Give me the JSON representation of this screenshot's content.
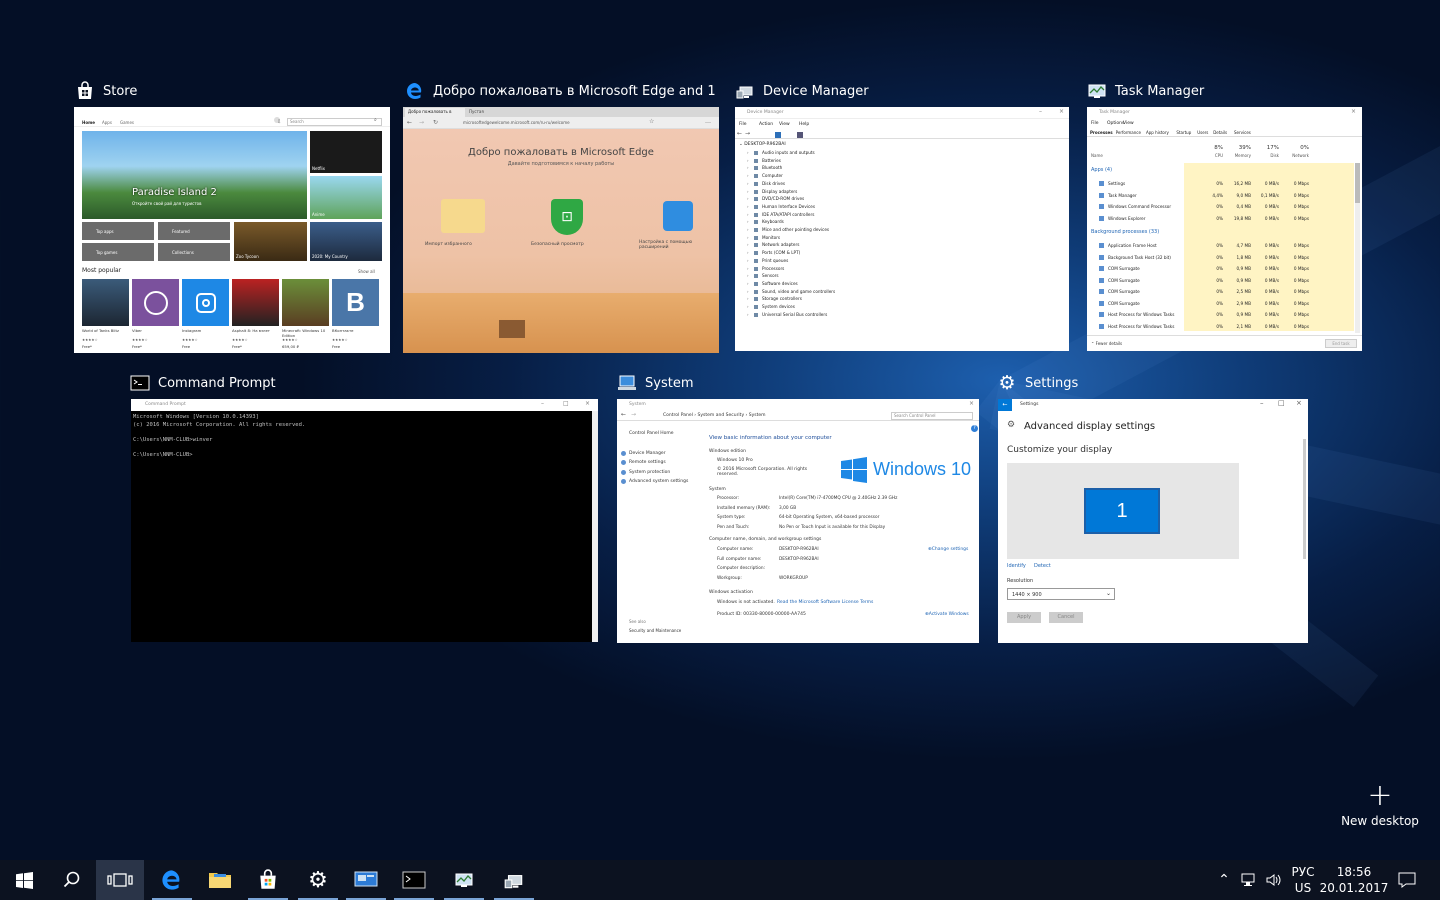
{
  "windows": {
    "store": {
      "title": "Store",
      "tabs": [
        "Home",
        "Apps",
        "Games"
      ],
      "search_placeholder": "Search",
      "hero_title": "Paradise Island 2",
      "hero_sub": "Откройте свой рай для туристов",
      "tiles": [
        "Top apps",
        "Featured",
        "Top games",
        "Collections"
      ],
      "side_tiles": [
        "Netflix",
        "Anime",
        "Zoo Tycoon",
        "2020: My Country"
      ],
      "section": "Most popular",
      "show_all": "Show all",
      "apps": [
        {
          "name": "World of Tanks Blitz",
          "price": "Free*"
        },
        {
          "name": "Viber",
          "price": "Free*"
        },
        {
          "name": "Instagram",
          "price": "Free"
        },
        {
          "name": "Asphalt 8: На взлет",
          "price": "Free*"
        },
        {
          "name": "Minecraft: Windows 10 Edition",
          "price": "659,00 ₽"
        },
        {
          "name": "ВКонтакте",
          "price": "Free"
        }
      ]
    },
    "edge": {
      "title": "Добро пожаловать в Microsoft Edge and 1 m...",
      "tab": "Добро пожаловать в",
      "tab2": "Пустая",
      "address": "microsoftedgewelcome.microsoft.com/ru-ru/welcome",
      "heading": "Добро пожаловать в Microsoft Edge",
      "subheading": "Давайте подготовимся к началу работы",
      "features": [
        "Импорт избранного",
        "Безопасный просмотр",
        "Настройка с помощью расширений"
      ]
    },
    "device_manager": {
      "title": "Device Manager",
      "menu": [
        "File",
        "Action",
        "View",
        "Help"
      ],
      "root": "DESKTOP-R962BAI",
      "items": [
        "Audio inputs and outputs",
        "Batteries",
        "Bluetooth",
        "Computer",
        "Disk drives",
        "Display adapters",
        "DVD/CD-ROM drives",
        "Human Interface Devices",
        "IDE ATA/ATAPI controllers",
        "Keyboards",
        "Mice and other pointing devices",
        "Monitors",
        "Network adapters",
        "Ports (COM & LPT)",
        "Print queues",
        "Processors",
        "Sensors",
        "Software devices",
        "Sound, video and game controllers",
        "Storage controllers",
        "System devices",
        "Universal Serial Bus controllers"
      ]
    },
    "task_manager": {
      "title": "Task Manager",
      "menu": [
        "File",
        "Options",
        "View"
      ],
      "tabs": [
        "Processes",
        "Performance",
        "App history",
        "Startup",
        "Users",
        "Details",
        "Services"
      ],
      "col_name": "Name",
      "cols": [
        {
          "pct": "8%",
          "label": "CPU"
        },
        {
          "pct": "39%",
          "label": "Memory"
        },
        {
          "pct": "17%",
          "label": "Disk"
        },
        {
          "pct": "0%",
          "label": "Network"
        }
      ],
      "apps_header": "Apps (4)",
      "apps": [
        {
          "name": "Settings",
          "cpu": "0%",
          "mem": "16,2 MB",
          "disk": "0 MB/s",
          "net": "0 Mbps"
        },
        {
          "name": "Task Manager",
          "cpu": "4,4%",
          "mem": "9,0 MB",
          "disk": "0,1 MB/s",
          "net": "0 Mbps"
        },
        {
          "name": "Windows Command Processor",
          "cpu": "0%",
          "mem": "0,4 MB",
          "disk": "0 MB/s",
          "net": "0 Mbps"
        },
        {
          "name": "Windows Explorer",
          "cpu": "0%",
          "mem": "19,8 MB",
          "disk": "0 MB/s",
          "net": "0 Mbps"
        }
      ],
      "bg_header": "Background processes (33)",
      "bg": [
        {
          "name": "Application Frame Host",
          "cpu": "0%",
          "mem": "4,7 MB",
          "disk": "0 MB/s",
          "net": "0 Mbps"
        },
        {
          "name": "Background Task Host (32 bit)",
          "cpu": "0%",
          "mem": "1,8 MB",
          "disk": "0 MB/s",
          "net": "0 Mbps"
        },
        {
          "name": "COM Surrogate",
          "cpu": "0%",
          "mem": "0,9 MB",
          "disk": "0 MB/s",
          "net": "0 Mbps"
        },
        {
          "name": "COM Surrogate",
          "cpu": "0%",
          "mem": "0,9 MB",
          "disk": "0 MB/s",
          "net": "0 Mbps"
        },
        {
          "name": "COM Surrogate",
          "cpu": "0%",
          "mem": "2,5 MB",
          "disk": "0 MB/s",
          "net": "0 Mbps"
        },
        {
          "name": "COM Surrogate",
          "cpu": "0%",
          "mem": "2,9 MB",
          "disk": "0 MB/s",
          "net": "0 Mbps"
        },
        {
          "name": "Host Process for Windows Tasks",
          "cpu": "0%",
          "mem": "0,9 MB",
          "disk": "0 MB/s",
          "net": "0 Mbps"
        },
        {
          "name": "Host Process for Windows Tasks",
          "cpu": "0%",
          "mem": "2,1 MB",
          "disk": "0 MB/s",
          "net": "0 Mbps"
        }
      ],
      "fewer": "Fewer details",
      "end_task": "End task"
    },
    "cmd": {
      "title": "Command Prompt",
      "inner_title": "Command Prompt",
      "lines": [
        "Microsoft Windows [Version 10.0.14393]",
        "(c) 2016 Microsoft Corporation. All rights reserved.",
        "",
        "C:\\Users\\NNM-CLUB>winver",
        "",
        "C:\\Users\\NNM-CLUB>"
      ]
    },
    "system": {
      "title": "System",
      "inner_title": "System",
      "breadcrumb": [
        "Control Panel",
        "System and Security",
        "System"
      ],
      "search": "Search Control Panel",
      "left_links": [
        "Control Panel Home",
        "Device Manager",
        "Remote settings",
        "System protection",
        "Advanced system settings"
      ],
      "see_also": "See also",
      "see_also_link": "Security and Maintenance",
      "heading": "View basic information about your computer",
      "edition_hdr": "Windows edition",
      "edition": "Windows 10 Pro",
      "copyright": "© 2016 Microsoft Corporation. All rights reserved.",
      "logo": "Windows 10",
      "system_hdr": "System",
      "specs": [
        {
          "k": "Processor:",
          "v": "Intel(R) Core(TM) i7-4700MQ CPU @ 2.40GHz   2.39 GHz"
        },
        {
          "k": "Installed memory (RAM):",
          "v": "3,00 GB"
        },
        {
          "k": "System type:",
          "v": "64-bit Operating System, x64-based processor"
        },
        {
          "k": "Pen and Touch:",
          "v": "No Pen or Touch Input is available for this Display"
        }
      ],
      "name_hdr": "Computer name, domain, and workgroup settings",
      "names": [
        {
          "k": "Computer name:",
          "v": "DESKTOP-R962BAI"
        },
        {
          "k": "Full computer name:",
          "v": "DESKTOP-R962BAI"
        },
        {
          "k": "Computer description:",
          "v": ""
        },
        {
          "k": "Workgroup:",
          "v": "WORKGROUP"
        }
      ],
      "change": "Change settings",
      "act_hdr": "Windows activation",
      "act_status": "Windows is not activated.",
      "act_link": "Read the Microsoft Software License Terms",
      "product_id": "Product ID: 00330-80000-00000-AA745",
      "activate": "Activate Windows"
    },
    "settings": {
      "title": "Settings",
      "inner_title": "Settings",
      "heading": "Advanced display settings",
      "customize": "Customize your display",
      "monitor": "1",
      "identify": "Identify",
      "detect": "Detect",
      "res_label": "Resolution",
      "res_value": "1440 × 900",
      "apply": "Apply",
      "cancel": "Cancel"
    }
  },
  "new_desktop": "New desktop",
  "tray": {
    "lang": "РУС",
    "layout": "US",
    "time": "18:56",
    "date": "20.01.2017"
  },
  "colors": {
    "accent": "#0078d7",
    "taskbar": "#0c1220",
    "tm_heat": "#fff4c4"
  }
}
